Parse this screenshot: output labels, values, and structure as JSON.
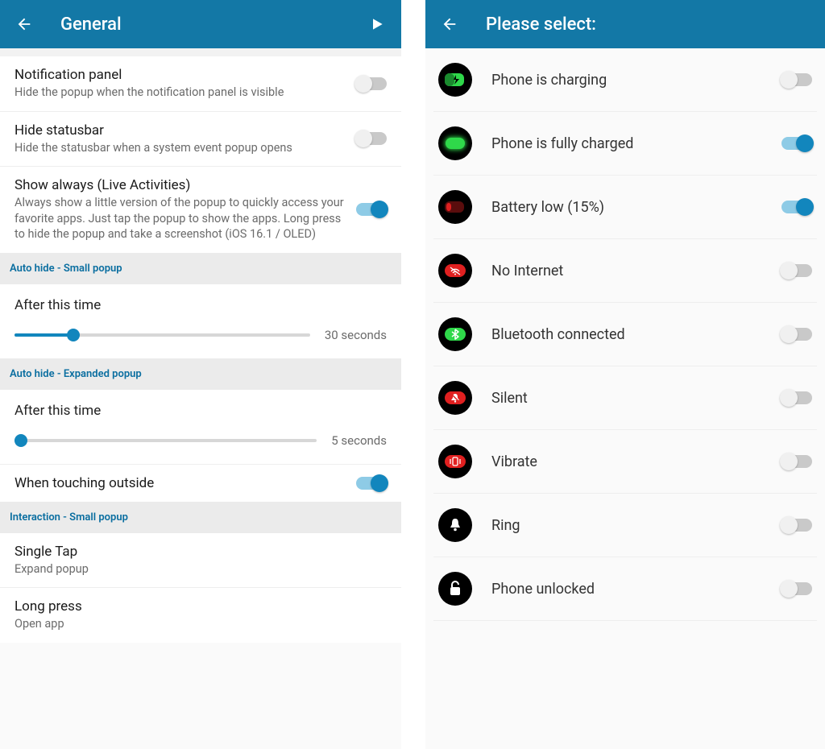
{
  "left": {
    "title": "General",
    "items": [
      {
        "title": "Notification panel",
        "sub": "Hide the popup when the notification panel is visible",
        "on": false
      },
      {
        "title": "Hide statusbar",
        "sub": "Hide the statusbar when a system event popup opens",
        "on": false
      },
      {
        "title": "Show always (Live Activities)",
        "sub": "Always show a little version of the popup to quickly access your favorite apps. Just tap the popup to show the apps. Long press to hide the popup and take a screenshot (iOS 16.1 / OLED)",
        "on": true
      }
    ],
    "section1": "Auto hide - Small popup",
    "slider1": {
      "title": "After this time",
      "label": "30 seconds",
      "pct": 20
    },
    "section2": "Auto hide - Expanded popup",
    "slider2": {
      "title": "After this time",
      "label": "5 seconds",
      "pct": 2
    },
    "outside": {
      "title": "When touching outside",
      "on": true
    },
    "section3": "Interaction - Small popup",
    "tap": {
      "title": "Single Tap",
      "sub": "Expand popup"
    },
    "long": {
      "title": "Long press",
      "sub": "Open app"
    }
  },
  "right": {
    "title": "Please select:",
    "items": [
      {
        "label": "Phone is charging",
        "on": false,
        "icon": "battery-charging"
      },
      {
        "label": "Phone is fully charged",
        "on": true,
        "icon": "battery-full"
      },
      {
        "label": "Battery low (15%)",
        "on": true,
        "icon": "battery-low"
      },
      {
        "label": "No Internet",
        "on": false,
        "icon": "wifi-off"
      },
      {
        "label": "Bluetooth connected",
        "on": false,
        "icon": "bluetooth"
      },
      {
        "label": "Silent",
        "on": false,
        "icon": "bell-off"
      },
      {
        "label": "Vibrate",
        "on": false,
        "icon": "vibrate"
      },
      {
        "label": "Ring",
        "on": false,
        "icon": "bell"
      },
      {
        "label": "Phone unlocked",
        "on": false,
        "icon": "unlock"
      }
    ]
  }
}
